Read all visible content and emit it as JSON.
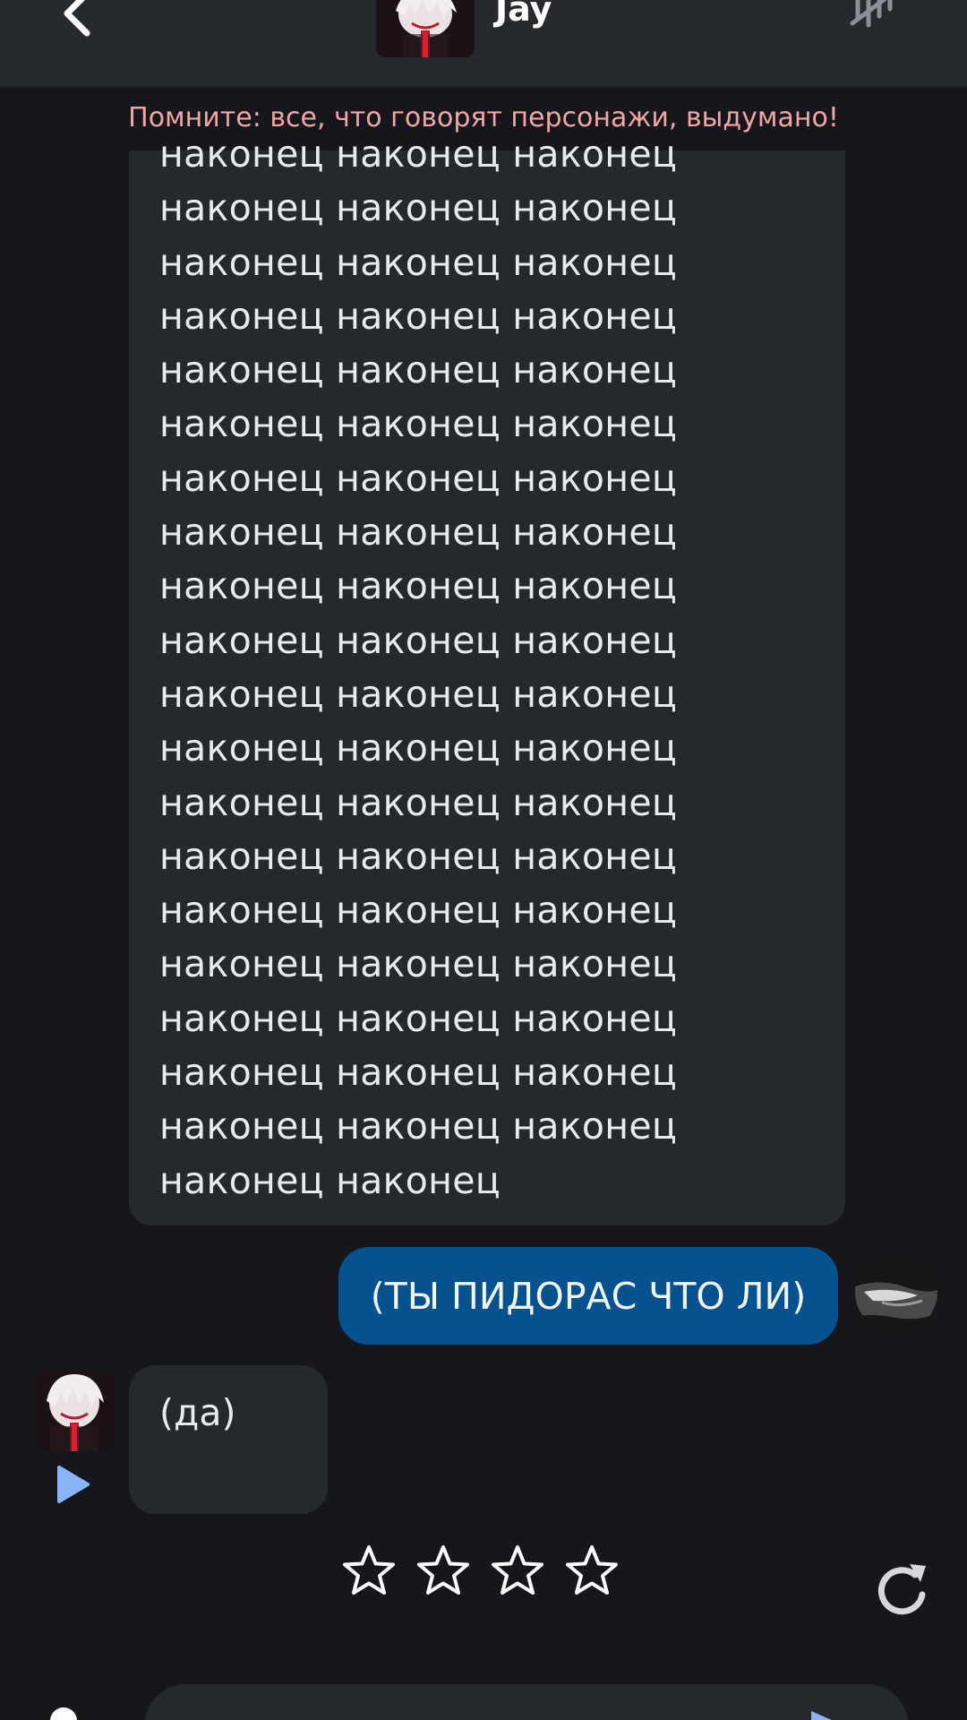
{
  "header": {
    "name": "Jay",
    "back_icon": "chevron-left-icon",
    "menu_icon": "wave-menu-icon"
  },
  "disclaimer": "Помните: все, что говорят персонажи, выдумано!",
  "messages": [
    {
      "role": "ai",
      "lines": [
        "наконец наконец наконец",
        "наконец наконец наконец",
        "наконец наконец наконец",
        "наконец наконец наконец",
        "наконец наконец наконец",
        "наконец наконец наконец",
        "наконец наконец наконец",
        "наконец наконец наконец",
        "наконец наконец наконец",
        "наконец наконец наконец",
        "наконец наконец наконец",
        "наконец наконец наконец",
        "наконец наконец наконец",
        "наконец наконец наконец",
        "наконец наконец наконец",
        "наконец наконец наконец",
        "наконец наконец наконец",
        "наконец наконец наконец",
        "наконец наконец наконец",
        "наконец наконец"
      ]
    },
    {
      "role": "user",
      "text": "(ТЫ ПИДОРАС ЧТО ЛИ)"
    },
    {
      "role": "ai",
      "text": "(да)"
    }
  ],
  "rating": {
    "stars_total": 4,
    "stars_filled": 0
  },
  "colors": {
    "background": "#16171c",
    "header": "#26292e",
    "ai_bubble": "#25292e",
    "user_bubble": "#06528f",
    "disclaimer": "#f2a5a3",
    "accent": "#8ab4f8"
  }
}
